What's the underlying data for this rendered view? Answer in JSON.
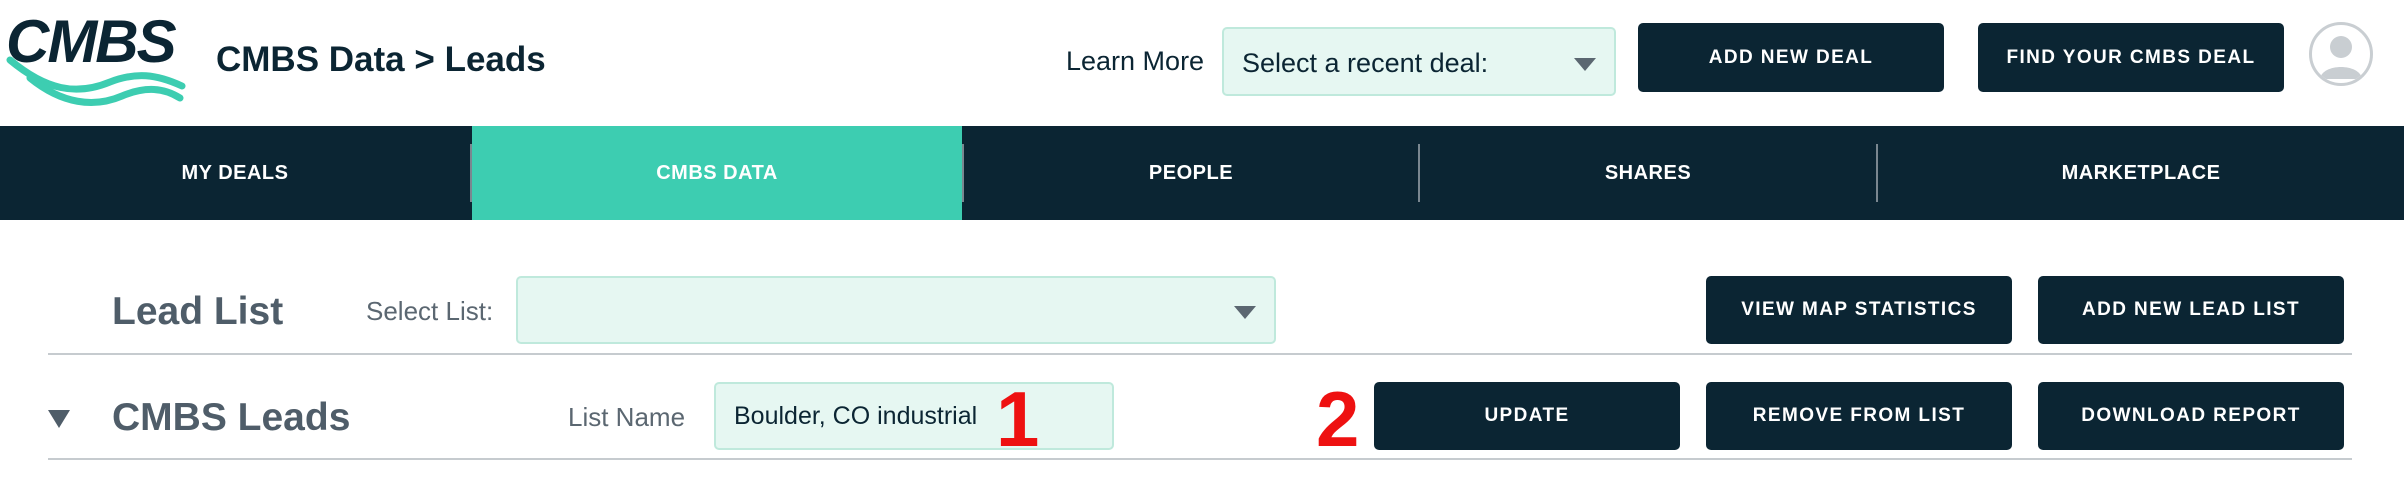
{
  "header": {
    "logo_text": "CMBS",
    "title_part1": "CMBS Data",
    "title_sep": ">",
    "title_part2": "Leads",
    "learn_more": "Learn More",
    "recent_deal_select": "Select a recent deal:",
    "add_new_deal": "ADD NEW DEAL",
    "find_deal": "FIND YOUR CMBS DEAL"
  },
  "nav": {
    "items": [
      {
        "label": "MY DEALS",
        "active": false
      },
      {
        "label": "CMBS DATA",
        "active": true
      },
      {
        "label": "PEOPLE",
        "active": false
      },
      {
        "label": "SHARES",
        "active": false
      },
      {
        "label": "MARKETPLACE",
        "active": false
      }
    ]
  },
  "lead_list": {
    "title": "Lead List",
    "select_label": "Select List:",
    "select_value": "",
    "view_map_stats": "VIEW MAP STATISTICS",
    "add_new_lead_list": "ADD NEW LEAD LIST"
  },
  "cmbs_leads": {
    "title": "CMBS Leads",
    "list_name_label": "List Name",
    "list_name_value": "Boulder, CO industrial",
    "marker_1": "1",
    "marker_2": "2",
    "update": "UPDATE",
    "remove_from_list": "REMOVE FROM LIST",
    "download_report": "DOWNLOAD REPORT"
  },
  "colors": {
    "navy": "#0b2533",
    "teal": "#3dcdb1",
    "input_bg": "#e6f7f2",
    "marker_red": "#ee1111"
  }
}
